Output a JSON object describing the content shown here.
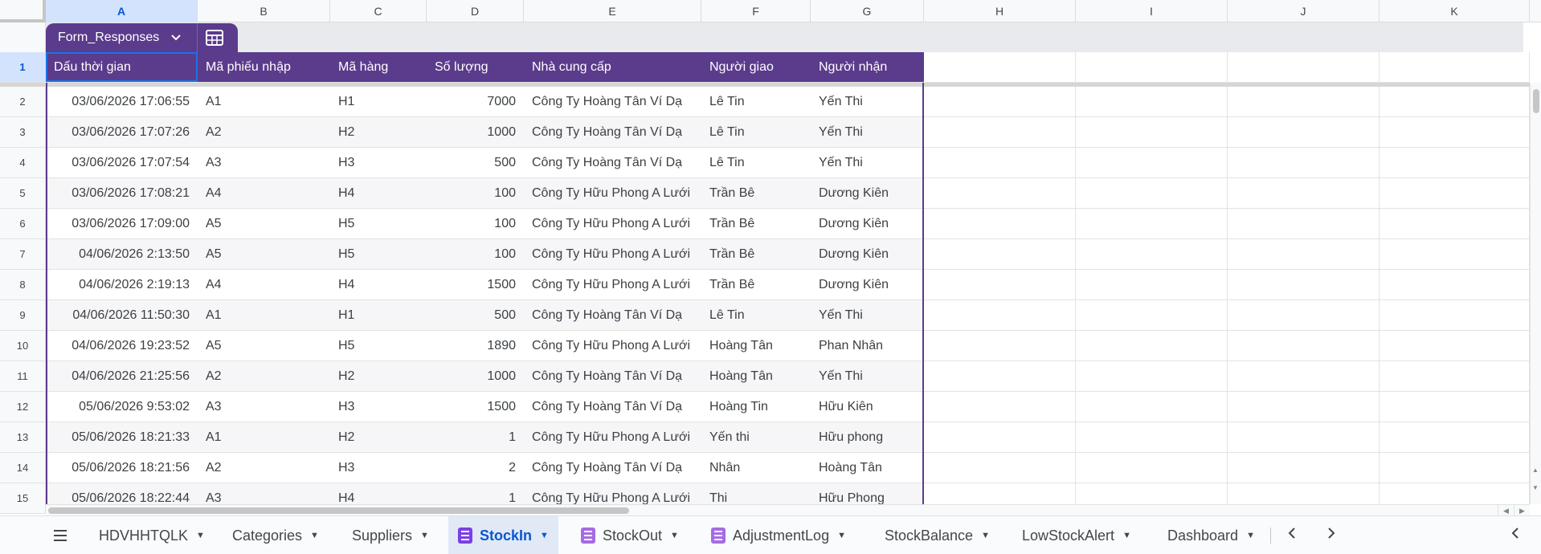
{
  "columns": [
    "A",
    "B",
    "C",
    "D",
    "E",
    "F",
    "G",
    "H",
    "I",
    "J",
    "K"
  ],
  "table": {
    "name": "Form_Responses",
    "headers": [
      "Dấu thời gian",
      "Mã phiếu nhập",
      "Mã hàng",
      "Số lượng",
      "Nhà cung cấp",
      "Người giao",
      "Người nhận"
    ]
  },
  "rows": [
    {
      "n": "2",
      "ts": "03/06/2026 17:06:55",
      "pn": "A1",
      "mh": "H1",
      "sl": "7000",
      "ncc": "Công Ty Hoàng Tân Ví Dạ",
      "ng": "Lê Tin",
      "nn": "Yến Thi"
    },
    {
      "n": "3",
      "ts": "03/06/2026 17:07:26",
      "pn": "A2",
      "mh": "H2",
      "sl": "1000",
      "ncc": "Công Ty Hoàng Tân Ví Dạ",
      "ng": "Lê Tin",
      "nn": "Yến Thi"
    },
    {
      "n": "4",
      "ts": "03/06/2026 17:07:54",
      "pn": "A3",
      "mh": "H3",
      "sl": "500",
      "ncc": "Công Ty Hoàng Tân Ví Dạ",
      "ng": "Lê Tin",
      "nn": "Yến Thi"
    },
    {
      "n": "5",
      "ts": "03/06/2026 17:08:21",
      "pn": "A4",
      "mh": "H4",
      "sl": "100",
      "ncc": "Công Ty Hữu Phong A Lưới",
      "ng": "Trần Bê",
      "nn": "Dương Kiên"
    },
    {
      "n": "6",
      "ts": "03/06/2026 17:09:00",
      "pn": "A5",
      "mh": "H5",
      "sl": "100",
      "ncc": "Công Ty Hữu Phong A Lưới",
      "ng": "Trần Bê",
      "nn": "Dương Kiên"
    },
    {
      "n": "7",
      "ts": "04/06/2026 2:13:50",
      "pn": "A5",
      "mh": "H5",
      "sl": "100",
      "ncc": "Công Ty Hữu Phong A Lưới",
      "ng": "Trần Bê",
      "nn": "Dương Kiên"
    },
    {
      "n": "8",
      "ts": "04/06/2026 2:19:13",
      "pn": "A4",
      "mh": "H4",
      "sl": "1500",
      "ncc": "Công Ty Hữu Phong A Lưới",
      "ng": "Trần Bê",
      "nn": "Dương Kiên"
    },
    {
      "n": "9",
      "ts": "04/06/2026 11:50:30",
      "pn": "A1",
      "mh": "H1",
      "sl": "500",
      "ncc": "Công Ty Hoàng Tân Ví Dạ",
      "ng": "Lê Tin",
      "nn": "Yến Thi"
    },
    {
      "n": "10",
      "ts": "04/06/2026 19:23:52",
      "pn": "A5",
      "mh": "H5",
      "sl": "1890",
      "ncc": "Công Ty Hữu Phong A Lưới",
      "ng": "Hoàng Tân",
      "nn": "Phan Nhân"
    },
    {
      "n": "11",
      "ts": "04/06/2026 21:25:56",
      "pn": "A2",
      "mh": "H2",
      "sl": "1000",
      "ncc": "Công Ty Hoàng Tân Ví Dạ",
      "ng": "Hoàng Tân",
      "nn": "Yến Thi"
    },
    {
      "n": "12",
      "ts": "05/06/2026 9:53:02",
      "pn": "A3",
      "mh": "H3",
      "sl": "1500",
      "ncc": "Công Ty Hoàng Tân Ví Dạ",
      "ng": "Hoàng Tin",
      "nn": "Hữu Kiên"
    },
    {
      "n": "13",
      "ts": "05/06/2026 18:21:33",
      "pn": "A1",
      "mh": "H2",
      "sl": "1",
      "ncc": "Công Ty Hữu Phong A Lưới",
      "ng": "Yến thi",
      "nn": "Hữu phong"
    },
    {
      "n": "14",
      "ts": "05/06/2026 18:21:56",
      "pn": "A2",
      "mh": "H3",
      "sl": "2",
      "ncc": "Công Ty Hoàng Tân Ví Dạ",
      "ng": "Nhân",
      "nn": "Hoàng Tân"
    },
    {
      "n": "15",
      "ts": "05/06/2026 18:22:44",
      "pn": "A3",
      "mh": "H4",
      "sl": "1",
      "ncc": "Công Ty Hữu Phong A Lưới",
      "ng": "Thi",
      "nn": "Hữu Phong"
    }
  ],
  "header_row_number": "1",
  "sheets": [
    {
      "label": "HDVHHTQLK",
      "icon": false,
      "active": false
    },
    {
      "label": "Categories",
      "icon": false,
      "active": false
    },
    {
      "label": "Suppliers",
      "icon": false,
      "active": false
    },
    {
      "label": "StockIn",
      "icon": true,
      "active": true
    },
    {
      "label": "StockOut",
      "icon": true,
      "active": false
    },
    {
      "label": "AdjustmentLog",
      "icon": true,
      "active": false
    },
    {
      "label": "StockBalance",
      "icon": false,
      "active": false
    },
    {
      "label": "LowStockAlert",
      "icon": false,
      "active": false
    },
    {
      "label": "Dashboard",
      "icon": false,
      "active": false
    }
  ],
  "icons": {
    "all_sheets": "hamburger-menu-icon",
    "table_dropdown": "chevron-down-icon",
    "table_calc": "table-grid-icon",
    "prev": "chevron-left-icon",
    "next": "chevron-right-icon",
    "collapse": "chevron-left-icon"
  },
  "colors": {
    "table_header": "#5b3b8c",
    "active_tab": "#0b57d0",
    "selection": "#1a73e8"
  }
}
